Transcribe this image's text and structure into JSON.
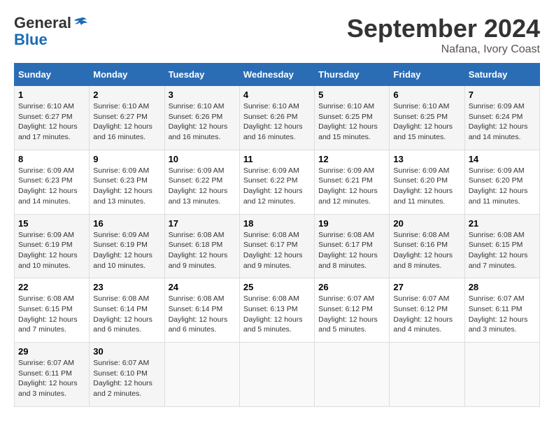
{
  "header": {
    "logo_general": "General",
    "logo_blue": "Blue",
    "month": "September 2024",
    "location": "Nafana, Ivory Coast"
  },
  "weekdays": [
    "Sunday",
    "Monday",
    "Tuesday",
    "Wednesday",
    "Thursday",
    "Friday",
    "Saturday"
  ],
  "weeks": [
    [
      {
        "day": "1",
        "sunrise": "6:10 AM",
        "sunset": "6:27 PM",
        "daylight": "12 hours and 17 minutes."
      },
      {
        "day": "2",
        "sunrise": "6:10 AM",
        "sunset": "6:27 PM",
        "daylight": "12 hours and 16 minutes."
      },
      {
        "day": "3",
        "sunrise": "6:10 AM",
        "sunset": "6:26 PM",
        "daylight": "12 hours and 16 minutes."
      },
      {
        "day": "4",
        "sunrise": "6:10 AM",
        "sunset": "6:26 PM",
        "daylight": "12 hours and 16 minutes."
      },
      {
        "day": "5",
        "sunrise": "6:10 AM",
        "sunset": "6:25 PM",
        "daylight": "12 hours and 15 minutes."
      },
      {
        "day": "6",
        "sunrise": "6:10 AM",
        "sunset": "6:25 PM",
        "daylight": "12 hours and 15 minutes."
      },
      {
        "day": "7",
        "sunrise": "6:09 AM",
        "sunset": "6:24 PM",
        "daylight": "12 hours and 14 minutes."
      }
    ],
    [
      {
        "day": "8",
        "sunrise": "6:09 AM",
        "sunset": "6:23 PM",
        "daylight": "12 hours and 14 minutes."
      },
      {
        "day": "9",
        "sunrise": "6:09 AM",
        "sunset": "6:23 PM",
        "daylight": "12 hours and 13 minutes."
      },
      {
        "day": "10",
        "sunrise": "6:09 AM",
        "sunset": "6:22 PM",
        "daylight": "12 hours and 13 minutes."
      },
      {
        "day": "11",
        "sunrise": "6:09 AM",
        "sunset": "6:22 PM",
        "daylight": "12 hours and 12 minutes."
      },
      {
        "day": "12",
        "sunrise": "6:09 AM",
        "sunset": "6:21 PM",
        "daylight": "12 hours and 12 minutes."
      },
      {
        "day": "13",
        "sunrise": "6:09 AM",
        "sunset": "6:20 PM",
        "daylight": "12 hours and 11 minutes."
      },
      {
        "day": "14",
        "sunrise": "6:09 AM",
        "sunset": "6:20 PM",
        "daylight": "12 hours and 11 minutes."
      }
    ],
    [
      {
        "day": "15",
        "sunrise": "6:09 AM",
        "sunset": "6:19 PM",
        "daylight": "12 hours and 10 minutes."
      },
      {
        "day": "16",
        "sunrise": "6:09 AM",
        "sunset": "6:19 PM",
        "daylight": "12 hours and 10 minutes."
      },
      {
        "day": "17",
        "sunrise": "6:08 AM",
        "sunset": "6:18 PM",
        "daylight": "12 hours and 9 minutes."
      },
      {
        "day": "18",
        "sunrise": "6:08 AM",
        "sunset": "6:17 PM",
        "daylight": "12 hours and 9 minutes."
      },
      {
        "day": "19",
        "sunrise": "6:08 AM",
        "sunset": "6:17 PM",
        "daylight": "12 hours and 8 minutes."
      },
      {
        "day": "20",
        "sunrise": "6:08 AM",
        "sunset": "6:16 PM",
        "daylight": "12 hours and 8 minutes."
      },
      {
        "day": "21",
        "sunrise": "6:08 AM",
        "sunset": "6:15 PM",
        "daylight": "12 hours and 7 minutes."
      }
    ],
    [
      {
        "day": "22",
        "sunrise": "6:08 AM",
        "sunset": "6:15 PM",
        "daylight": "12 hours and 7 minutes."
      },
      {
        "day": "23",
        "sunrise": "6:08 AM",
        "sunset": "6:14 PM",
        "daylight": "12 hours and 6 minutes."
      },
      {
        "day": "24",
        "sunrise": "6:08 AM",
        "sunset": "6:14 PM",
        "daylight": "12 hours and 6 minutes."
      },
      {
        "day": "25",
        "sunrise": "6:08 AM",
        "sunset": "6:13 PM",
        "daylight": "12 hours and 5 minutes."
      },
      {
        "day": "26",
        "sunrise": "6:07 AM",
        "sunset": "6:12 PM",
        "daylight": "12 hours and 5 minutes."
      },
      {
        "day": "27",
        "sunrise": "6:07 AM",
        "sunset": "6:12 PM",
        "daylight": "12 hours and 4 minutes."
      },
      {
        "day": "28",
        "sunrise": "6:07 AM",
        "sunset": "6:11 PM",
        "daylight": "12 hours and 3 minutes."
      }
    ],
    [
      {
        "day": "29",
        "sunrise": "6:07 AM",
        "sunset": "6:11 PM",
        "daylight": "12 hours and 3 minutes."
      },
      {
        "day": "30",
        "sunrise": "6:07 AM",
        "sunset": "6:10 PM",
        "daylight": "12 hours and 2 minutes."
      },
      null,
      null,
      null,
      null,
      null
    ]
  ]
}
